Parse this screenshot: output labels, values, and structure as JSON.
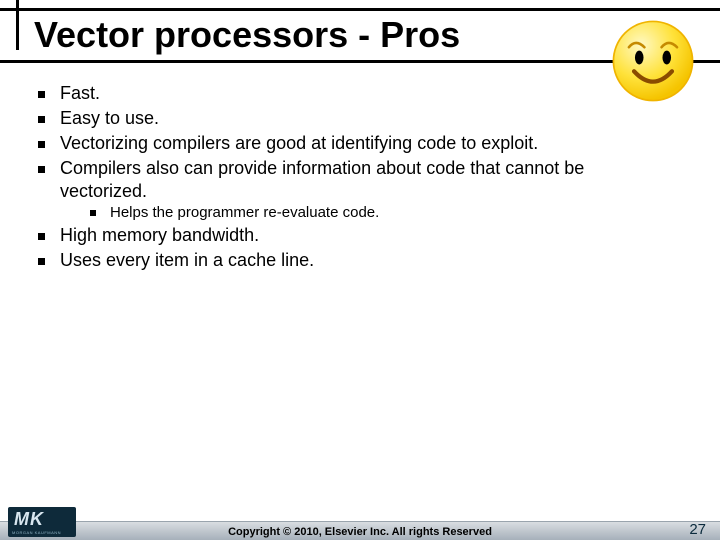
{
  "title": "Vector processors - Pros",
  "bullets": [
    {
      "text": "Fast."
    },
    {
      "text": "Easy to use."
    },
    {
      "text": "Vectorizing compilers are good at identifying code to exploit."
    },
    {
      "text": "Compilers also can provide information about code that cannot be vectorized.",
      "sub": [
        {
          "text": "Helps the programmer re-evaluate code."
        }
      ]
    },
    {
      "text": "High memory bandwidth."
    },
    {
      "text": "Uses every item in a cache line."
    }
  ],
  "footer": {
    "copyright": "Copyright © 2010, Elsevier Inc. All rights Reserved",
    "page": "27",
    "logo_main": "MK",
    "logo_sub": "MORGAN KAUFMANN"
  },
  "smiley": {
    "face_fill": "#ffe23a",
    "face_stroke": "#f0b400",
    "eye_fill": "#000",
    "mouth": "#8a4b00"
  }
}
